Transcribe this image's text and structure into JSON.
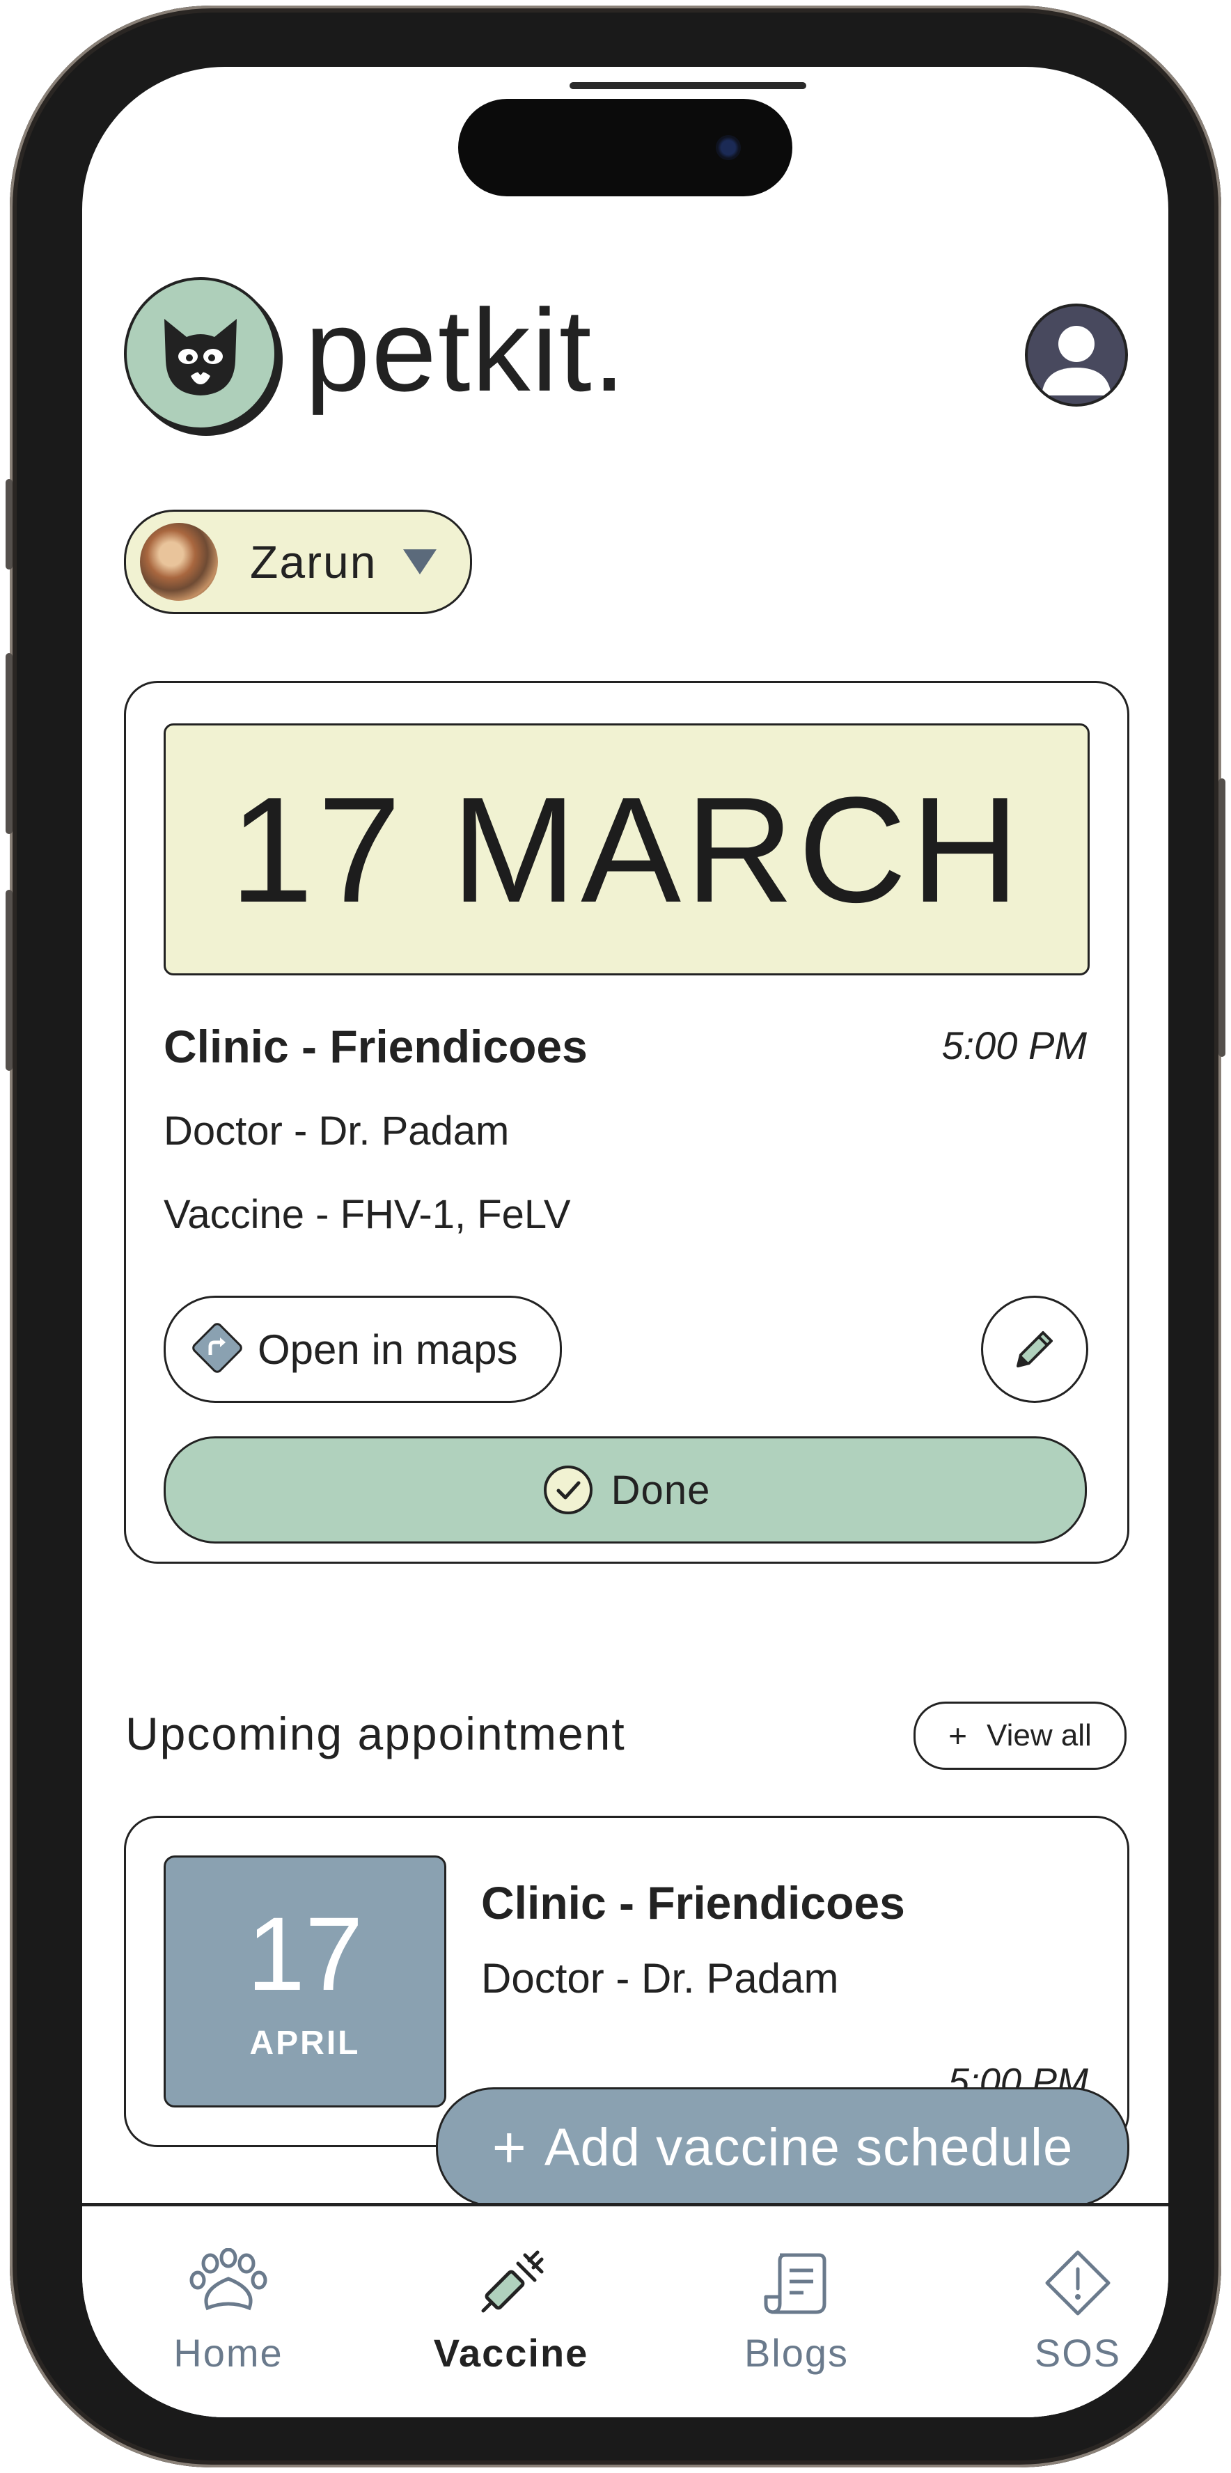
{
  "brand": {
    "name": "petkit."
  },
  "pet": {
    "name": "Zarun"
  },
  "current_appointment": {
    "date": "17 MARCH",
    "clinic": "Clinic - Friendicoes",
    "time": "5:00 PM",
    "doctor": "Doctor - Dr. Padam",
    "vaccine": "Vaccine - FHV-1, FeLV",
    "maps_label": "Open in maps",
    "done_label": "Done"
  },
  "upcoming": {
    "title": "Upcoming appointment",
    "view_all_plus": "+",
    "view_all_label": "View all",
    "items": [
      {
        "day": "17",
        "month": "APRIL",
        "clinic": "Clinic - Friendicoes",
        "doctor": "Doctor - Dr. Padam",
        "time": "5:00 PM"
      }
    ]
  },
  "fab": {
    "plus": "+",
    "label": "Add vaccine schedule"
  },
  "nav": {
    "items": [
      {
        "label": "Home",
        "icon": "paw-icon",
        "active": false
      },
      {
        "label": "Vaccine",
        "icon": "syringe-icon",
        "active": true
      },
      {
        "label": "Blogs",
        "icon": "scroll-icon",
        "active": false
      },
      {
        "label": "SOS",
        "icon": "alert-diamond-icon",
        "active": false
      }
    ]
  },
  "colors": {
    "mint": "#b0d1bd",
    "cream": "#f1f2d2",
    "slate_blue": "#8aa1b1",
    "ink": "#222222",
    "nav_inactive": "#6a7a8c"
  }
}
